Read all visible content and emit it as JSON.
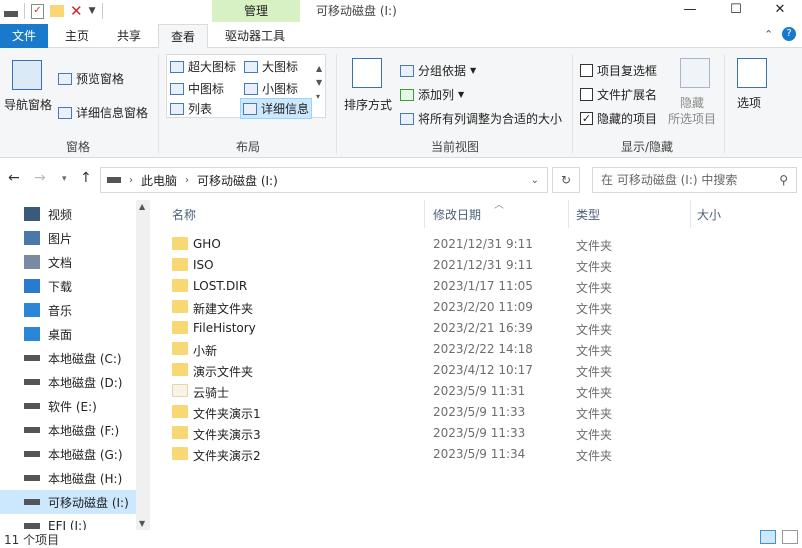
{
  "window": {
    "title": "可移动磁盘 (I:)",
    "context_tab": "管理",
    "min": "—",
    "max": "☐",
    "close": "✕"
  },
  "menu": {
    "file": "文件",
    "tabs": [
      "主页",
      "共享",
      "查看",
      "驱动器工具"
    ],
    "active": "查看"
  },
  "ribbon": {
    "nav_pane": "导航窗格",
    "preview_pane": "预览窗格",
    "details_pane": "详细信息窗格",
    "group_panes": "窗格",
    "layouts": [
      "超大图标",
      "大图标",
      "中图标",
      "小图标",
      "列表",
      "详细信息"
    ],
    "group_layout": "布局",
    "sort": "排序方式",
    "group_by": "分组依据",
    "add_column": "添加列",
    "fit_columns": "将所有列调整为合适的大小",
    "group_view": "当前视图",
    "item_checkbox": "项目复选框",
    "file_ext": "文件扩展名",
    "hidden_items": "隐藏的项目",
    "hide": "隐藏",
    "selected_items": "所选项目",
    "options": "选项",
    "group_show": "显示/隐藏"
  },
  "address": {
    "path": [
      "此电脑",
      "可移动磁盘 (I:)"
    ],
    "search_placeholder": "在 可移动磁盘 (I:) 中搜索"
  },
  "sidebar": [
    {
      "label": "视频",
      "icon": "video-icon"
    },
    {
      "label": "图片",
      "icon": "picture-icon"
    },
    {
      "label": "文档",
      "icon": "document-icon"
    },
    {
      "label": "下载",
      "icon": "download-icon"
    },
    {
      "label": "音乐",
      "icon": "music-icon"
    },
    {
      "label": "桌面",
      "icon": "desktop-icon"
    },
    {
      "label": "本地磁盘 (C:)",
      "icon": "drive-icon"
    },
    {
      "label": "本地磁盘 (D:)",
      "icon": "drive-icon"
    },
    {
      "label": "软件 (E:)",
      "icon": "drive-icon"
    },
    {
      "label": "本地磁盘 (F:)",
      "icon": "drive-icon"
    },
    {
      "label": "本地磁盘 (G:)",
      "icon": "drive-icon"
    },
    {
      "label": "本地磁盘 (H:)",
      "icon": "drive-icon"
    },
    {
      "label": "可移动磁盘 (I:)",
      "icon": "usb-drive-icon"
    },
    {
      "label": "EFI (J:)",
      "icon": "drive-icon"
    }
  ],
  "columns": {
    "name": "名称",
    "date": "修改日期",
    "type": "类型",
    "size": "大小"
  },
  "files": [
    {
      "name": "GHO",
      "date": "2021/12/31 9:11",
      "type": "文件夹"
    },
    {
      "name": "ISO",
      "date": "2021/12/31 9:11",
      "type": "文件夹"
    },
    {
      "name": "LOST.DIR",
      "date": "2023/1/17 11:05",
      "type": "文件夹"
    },
    {
      "name": "新建文件夹",
      "date": "2023/2/20 11:09",
      "type": "文件夹"
    },
    {
      "name": "FileHistory",
      "date": "2023/2/21 16:39",
      "type": "文件夹"
    },
    {
      "name": "小新",
      "date": "2023/2/22 14:18",
      "type": "文件夹"
    },
    {
      "name": "演示文件夹",
      "date": "2023/4/12 10:17",
      "type": "文件夹"
    },
    {
      "name": "云骑士",
      "date": "2023/5/9 11:31",
      "type": "文件夹"
    },
    {
      "name": "文件夹演示1",
      "date": "2023/5/9 11:33",
      "type": "文件夹"
    },
    {
      "name": "文件夹演示3",
      "date": "2023/5/9 11:33",
      "type": "文件夹"
    },
    {
      "name": "文件夹演示2",
      "date": "2023/5/9 11:34",
      "type": "文件夹"
    }
  ],
  "status": "11 个项目"
}
